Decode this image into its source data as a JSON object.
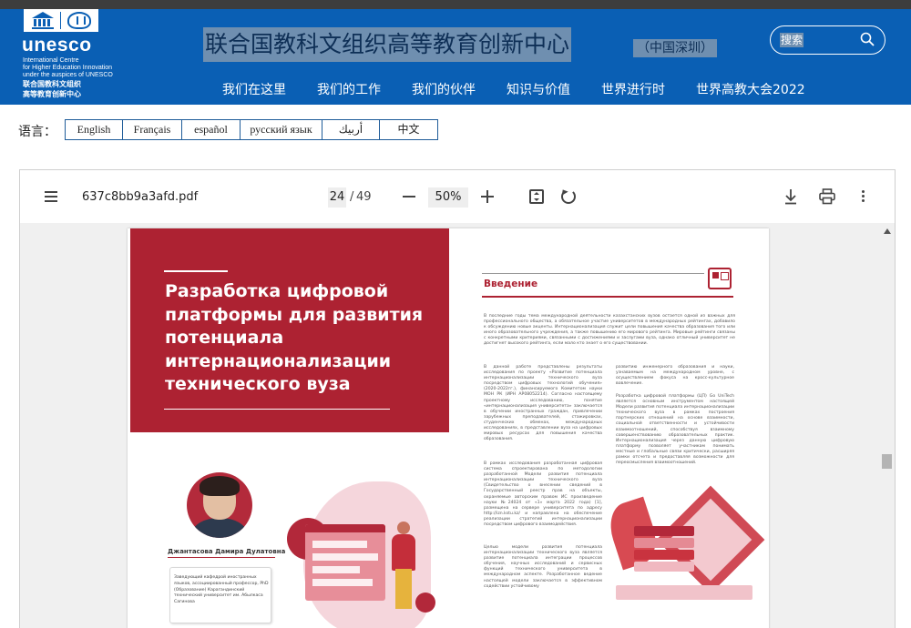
{
  "header": {
    "logo_word": "unesco",
    "logo_lines": [
      "International Centre",
      "for Higher Education Innovation",
      "under the auspices of UNESCO"
    ],
    "logo_cn_lines": [
      "联合国教科文组织",
      "高等教育创新中心"
    ],
    "site_title": "联合国教科文组织高等教育创新中心",
    "site_subtitle": "（中国深圳）",
    "search_placeholder": "搜索",
    "nav": [
      "我们在这里",
      "我们的工作",
      "我们的伙伴",
      "知识与价值",
      "世界进行时",
      "世界高教大会2022"
    ]
  },
  "language": {
    "label": "语言：",
    "options": [
      "English",
      "Français",
      "español",
      "русский язык",
      "أربيك",
      "中文"
    ]
  },
  "pdf_viewer": {
    "file_name": "637c8bb9a3afd.pdf",
    "current_page": "24",
    "page_separator": "/",
    "total_pages": "49",
    "zoom": "50%",
    "icons": [
      "menu-icon",
      "zoom-out-icon",
      "zoom-in-icon",
      "fit-page-icon",
      "rotate-icon",
      "download-icon",
      "print-icon",
      "more-options-icon"
    ]
  },
  "page": {
    "article_title": "Разработка цифровой платформы для развития потенциала интернационализации технического вуза",
    "author_name": "Джантасова Дамира Дулатовна",
    "author_bio": "Заведующий кафедрой иностранных языков, ассоциированный профессор, PhD (Образование) Карагандинский технический университет им. Абылкаса Сагинова",
    "intro_heading": "Введение",
    "intro_paragraph": "В последние годы тема международной деятельности казахстанских вузов остается одной из важных для профессионального общества, а обязательное участие университетов в международных рейтингах, добавило к обсуждению новые акценты. Интернационализация служит цели повышения качества образования того или иного образовательного учреждения, а также повышению его мирового рейтинга. Мировые рейтинги связаны с конкретными критериями, связанными с достижениями и заслугами вуза, однако отличный университет не достигнет высокого рейтинга, если мало кто знает о его существовании.",
    "col1_p1": "В данной работе представлены результаты исследования по проекту «Развитие потенциала интернационализации технического вуза посредством цифровых технологий обучения» (2020-2022гг.), финансируемого Комитетом науки МОН РК (ИРН AP08052214). Согласно настоящему проектному исследованию, понятие «интернационализация университета» заключается в обучении иностранных граждан, привлечении зарубежных преподавателей, стажировках, студенческих обменах, международных исследованиях, в представлении вуза на цифровых мировых ресурсах для повышения качества образования.",
    "col1_p2": "В рамках исследования разработанная цифровая система спроектирована по методологии разработанной Модели развития потенциала интернационализации технического вуза (Свидетельство о внесении сведений в Государственный реестр прав на объекты, охраняемые авторским правом ИС произведение науки №24024 от «1» марта 2022 года) [1], размещена на сервере университета по адресу http://izn.kstu.kz/ и направлена на обеспечение реализации стратегий интернационализации посредством цифрового взаимодействия.",
    "col1_p3": "Целью модели развития потенциала интернационализации технического вуза является развитие потенциала интеграции процессов обучения, научных исследований и сервисных функций технического университета в международном аспекте. Разработанное ведение настоящей модели заключается в эффективном содействии устойчивому",
    "col2_p1": "развитию инженерного образования и науки, узнаваемым на международном уровне, с осуществлением фокуса на кросс-культурное вовлечение.",
    "col2_p2": "Разработка цифровой платформы (ЦП) Go UniTech является основным инструментом настоящей Модели развития потенциала интернационализации технического вуза в рамках построения партнерских отношений на основе взаимности, социальной ответственности и устойчивости взаимоотношений, способствуя взаимному совершенствованию образовательных практик. Интернационализация через данную цифровую платформу позволяет участникам понимать местные и глобальные связи критически, расширяя рамки отсчета и предоставляя возможности для переосмысления взаимоотношений."
  },
  "colors": {
    "header_blue": "#0a5fb4",
    "accent_red": "#ad2232",
    "highlight": "#6f8fb0"
  }
}
